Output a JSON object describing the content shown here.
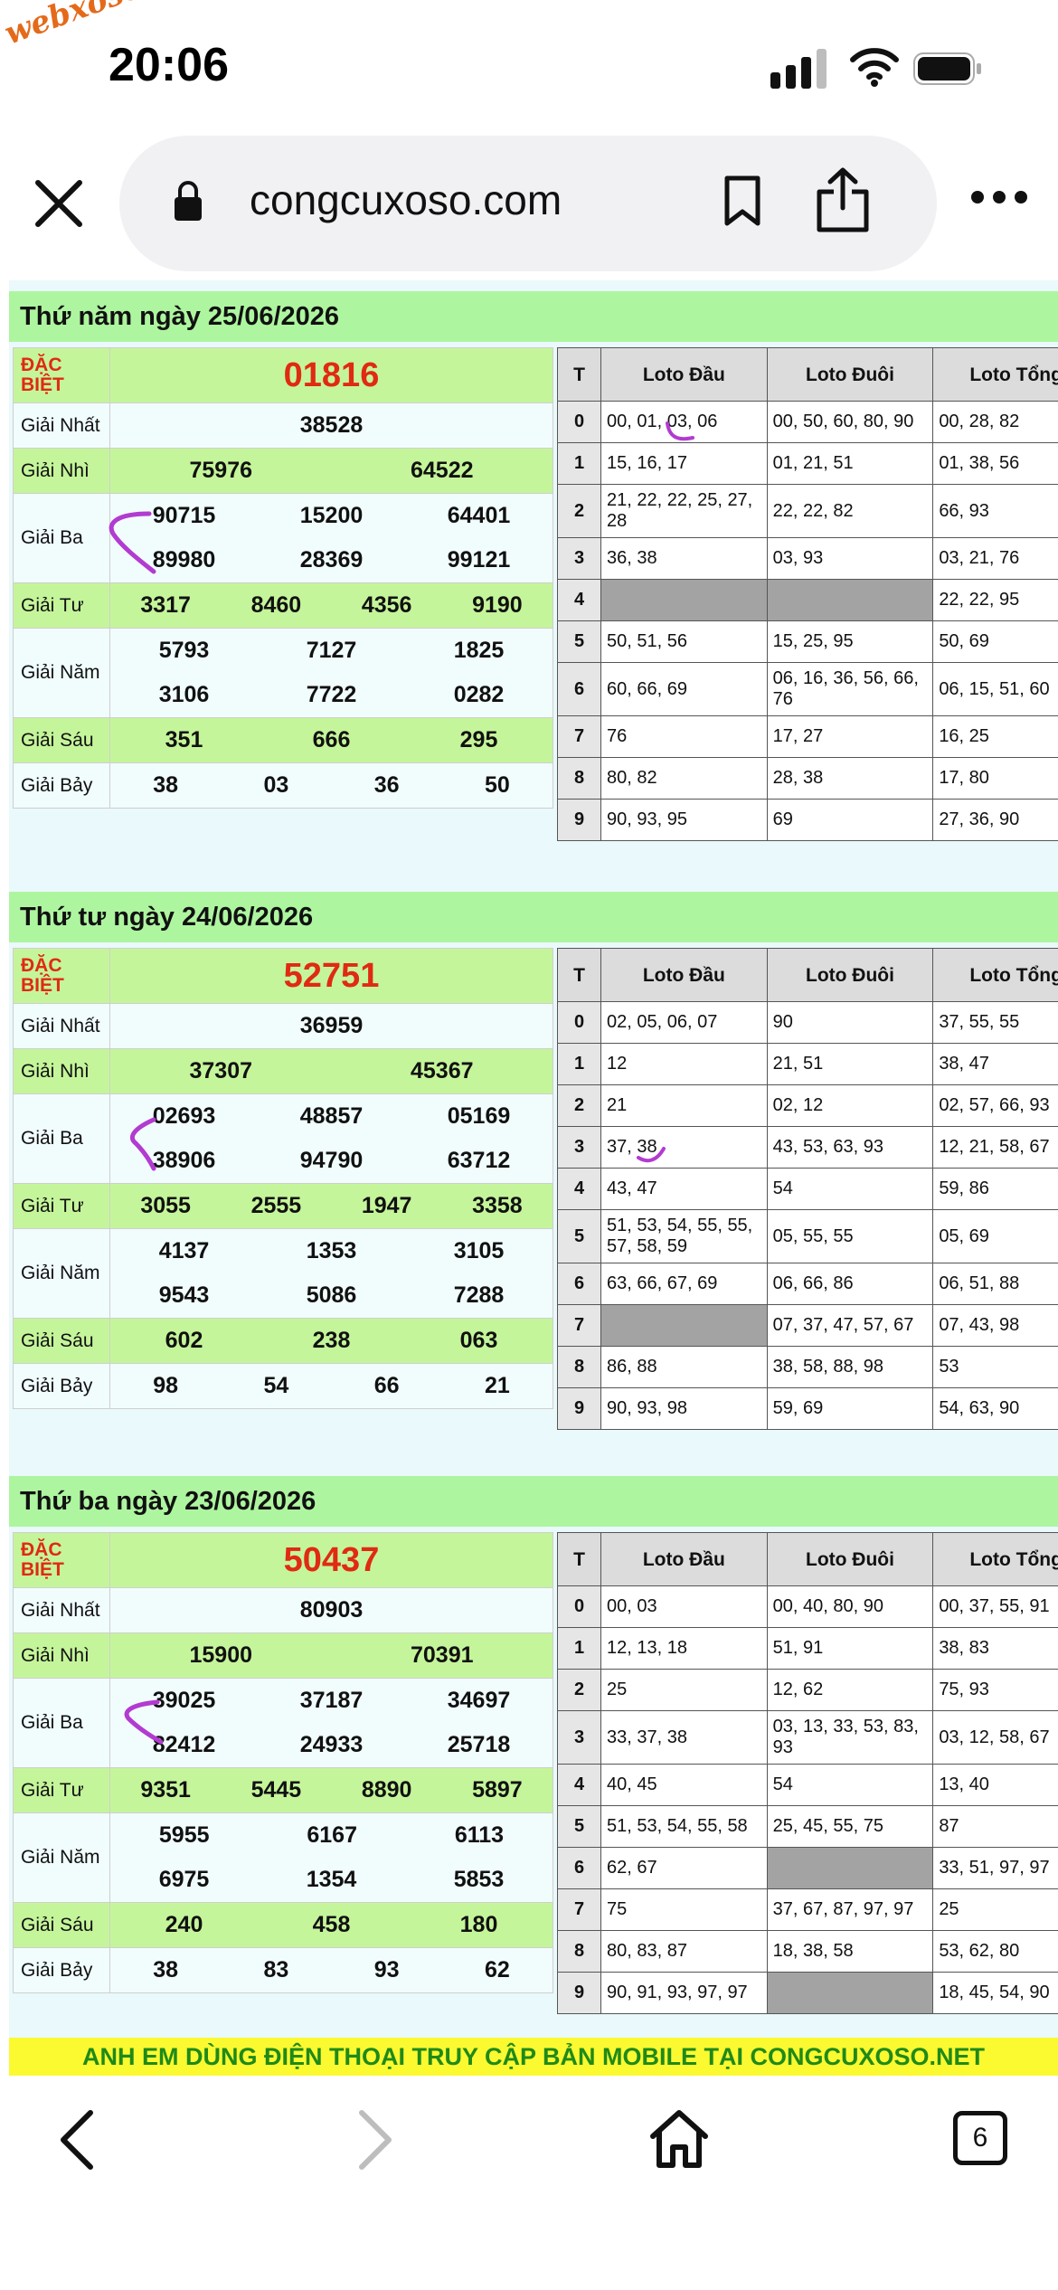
{
  "status": {
    "watermark": "webxoso.net",
    "time": "20:06"
  },
  "browser": {
    "url": "congcuxoso.com",
    "tab_count": "6"
  },
  "headers": {
    "t": "T",
    "dau": "Loto Đầu",
    "duoi": "Loto Đuôi",
    "tong": "Loto Tổng"
  },
  "labels": {
    "db": "ĐẶC BIỆT",
    "g1": "Giải Nhất",
    "g2": "Giải Nhì",
    "g3": "Giải Ba",
    "g4": "Giải Tư",
    "g5": "Giải Năm",
    "g6": "Giải Sáu",
    "g7": "Giải Bảy"
  },
  "days": [
    {
      "title": "Thứ năm ngày 25/06/2026",
      "db": "01816",
      "g1": "38528",
      "g2": [
        "75976",
        "64522"
      ],
      "g3a": [
        "90715",
        "15200",
        "64401"
      ],
      "g3b": [
        "89980",
        "28369",
        "99121"
      ],
      "g4": [
        "3317",
        "8460",
        "4356",
        "9190"
      ],
      "g5a": [
        "5793",
        "7127",
        "1825"
      ],
      "g5b": [
        "3106",
        "7722",
        "0282"
      ],
      "g6": [
        "351",
        "666",
        "295"
      ],
      "g7": [
        "38",
        "03",
        "36",
        "50"
      ],
      "loto": [
        {
          "t": "0",
          "dau": "00, 01, 03, 06",
          "duoi": "00, 50, 60, 80, 90",
          "tong": "00, 28, 82"
        },
        {
          "t": "1",
          "dau": "15, 16, 17",
          "duoi": "01, 21, 51",
          "tong": "01, 38, 56"
        },
        {
          "t": "2",
          "dau": "21, 22, 22, 25, 27, 28",
          "duoi": "22, 22, 82",
          "tong": "66, 93"
        },
        {
          "t": "3",
          "dau": "36, 38",
          "duoi": "03, 93",
          "tong": "03, 21, 76"
        },
        {
          "t": "4",
          "dau": "",
          "duoi": "",
          "tong": "22, 22, 95"
        },
        {
          "t": "5",
          "dau": "50, 51, 56",
          "duoi": "15, 25, 95",
          "tong": "50, 69"
        },
        {
          "t": "6",
          "dau": "60, 66, 69",
          "duoi": "06, 16, 36, 56, 66, 76",
          "tong": "06, 15, 51, 60"
        },
        {
          "t": "7",
          "dau": "76",
          "duoi": "17, 27",
          "tong": "16, 25"
        },
        {
          "t": "8",
          "dau": "80, 82",
          "duoi": "28, 38",
          "tong": "17, 80"
        },
        {
          "t": "9",
          "dau": "90, 93, 95",
          "duoi": "69",
          "tong": "27, 36, 90"
        }
      ]
    },
    {
      "title": "Thứ tư ngày 24/06/2026",
      "db": "52751",
      "g1": "36959",
      "g2": [
        "37307",
        "45367"
      ],
      "g3a": [
        "02693",
        "48857",
        "05169"
      ],
      "g3b": [
        "38906",
        "94790",
        "63712"
      ],
      "g4": [
        "3055",
        "2555",
        "1947",
        "3358"
      ],
      "g5a": [
        "4137",
        "1353",
        "3105"
      ],
      "g5b": [
        "9543",
        "5086",
        "7288"
      ],
      "g6": [
        "602",
        "238",
        "063"
      ],
      "g7": [
        "98",
        "54",
        "66",
        "21"
      ],
      "loto": [
        {
          "t": "0",
          "dau": "02, 05, 06, 07",
          "duoi": "90",
          "tong": "37, 55, 55"
        },
        {
          "t": "1",
          "dau": "12",
          "duoi": "21, 51",
          "tong": "38, 47"
        },
        {
          "t": "2",
          "dau": "21",
          "duoi": "02, 12",
          "tong": "02, 57, 66, 93"
        },
        {
          "t": "3",
          "dau": "37, 38",
          "duoi": "43, 53, 63, 93",
          "tong": "12, 21, 58, 67"
        },
        {
          "t": "4",
          "dau": "43, 47",
          "duoi": "54",
          "tong": "59, 86"
        },
        {
          "t": "5",
          "dau": "51, 53, 54, 55, 55, 57, 58, 59",
          "duoi": "05, 55, 55",
          "tong": "05, 69"
        },
        {
          "t": "6",
          "dau": "63, 66, 67, 69",
          "duoi": "06, 66, 86",
          "tong": "06, 51, 88"
        },
        {
          "t": "7",
          "dau": "",
          "duoi": "07, 37, 47, 57, 67",
          "tong": "07, 43, 98"
        },
        {
          "t": "8",
          "dau": "86, 88",
          "duoi": "38, 58, 88, 98",
          "tong": "53"
        },
        {
          "t": "9",
          "dau": "90, 93, 98",
          "duoi": "59, 69",
          "tong": "54, 63, 90"
        }
      ]
    },
    {
      "title": "Thứ ba ngày 23/06/2026",
      "db": "50437",
      "g1": "80903",
      "g2": [
        "15900",
        "70391"
      ],
      "g3a": [
        "39025",
        "37187",
        "34697"
      ],
      "g3b": [
        "82412",
        "24933",
        "25718"
      ],
      "g4": [
        "9351",
        "5445",
        "8890",
        "5897"
      ],
      "g5a": [
        "5955",
        "6167",
        "6113"
      ],
      "g5b": [
        "6975",
        "1354",
        "5853"
      ],
      "g6": [
        "240",
        "458",
        "180"
      ],
      "g7": [
        "38",
        "83",
        "93",
        "62"
      ],
      "loto": [
        {
          "t": "0",
          "dau": "00, 03",
          "duoi": "00, 40, 80, 90",
          "tong": "00, 37, 55, 91"
        },
        {
          "t": "1",
          "dau": "12, 13, 18",
          "duoi": "51, 91",
          "tong": "38, 83"
        },
        {
          "t": "2",
          "dau": "25",
          "duoi": "12, 62",
          "tong": "75, 93"
        },
        {
          "t": "3",
          "dau": "33, 37, 38",
          "duoi": "03, 13, 33, 53, 83, 93",
          "tong": "03, 12, 58, 67"
        },
        {
          "t": "4",
          "dau": "40, 45",
          "duoi": "54",
          "tong": "13, 40"
        },
        {
          "t": "5",
          "dau": "51, 53, 54, 55, 58",
          "duoi": "25, 45, 55, 75",
          "tong": "87"
        },
        {
          "t": "6",
          "dau": "62, 67",
          "duoi": "",
          "tong": "33, 51, 97, 97"
        },
        {
          "t": "7",
          "dau": "75",
          "duoi": "37, 67, 87, 97, 97",
          "tong": "25"
        },
        {
          "t": "8",
          "dau": "80, 83, 87",
          "duoi": "18, 38, 58",
          "tong": "53, 62, 80"
        },
        {
          "t": "9",
          "dau": "90, 91, 93, 97, 97",
          "duoi": "",
          "tong": "18, 45, 54, 90"
        }
      ]
    }
  ],
  "banner": "ANH EM DÙNG ĐIỆN THOẠI TRUY CẬP BẢN MOBILE TẠI CONGCUXOSO.NET",
  "colors": {
    "accent_red": "#e02a12",
    "title_green": "#aef5a0",
    "row_green": "#c5f59a",
    "banner_yellow": "#fbf930",
    "banner_text": "#1f8a19"
  }
}
